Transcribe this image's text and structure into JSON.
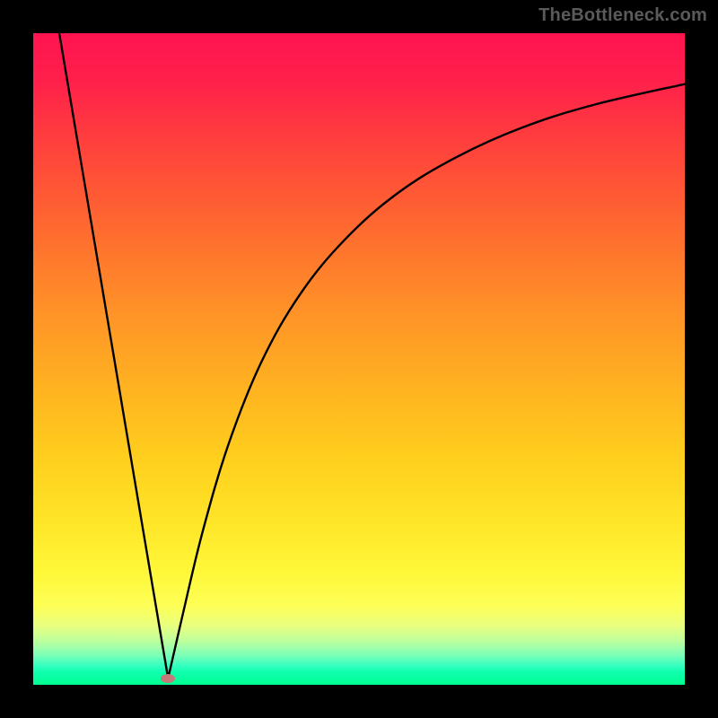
{
  "attribution": "TheBottleneck.com",
  "chart_data": {
    "type": "line",
    "title": "",
    "xlabel": "",
    "ylabel": "",
    "xlim": [
      0,
      1
    ],
    "ylim": [
      0,
      1
    ],
    "series": [
      {
        "name": "left-segment",
        "x": [
          0.04,
          0.207
        ],
        "y": [
          1.0,
          0.01
        ]
      },
      {
        "name": "right-curve",
        "x": [
          0.207,
          0.23,
          0.26,
          0.3,
          0.35,
          0.41,
          0.48,
          0.56,
          0.65,
          0.75,
          0.86,
          1.0
        ],
        "y": [
          0.01,
          0.11,
          0.235,
          0.37,
          0.495,
          0.6,
          0.685,
          0.755,
          0.81,
          0.855,
          0.89,
          0.922
        ]
      }
    ],
    "marker": {
      "x": 0.207,
      "y": 0.01,
      "color": "#c37a78"
    },
    "gradient_colors": {
      "top": "#ff1450",
      "mid_upper": "#ff9926",
      "mid_lower": "#fff83a",
      "bottom": "#00ff90"
    },
    "background": "#000000"
  }
}
